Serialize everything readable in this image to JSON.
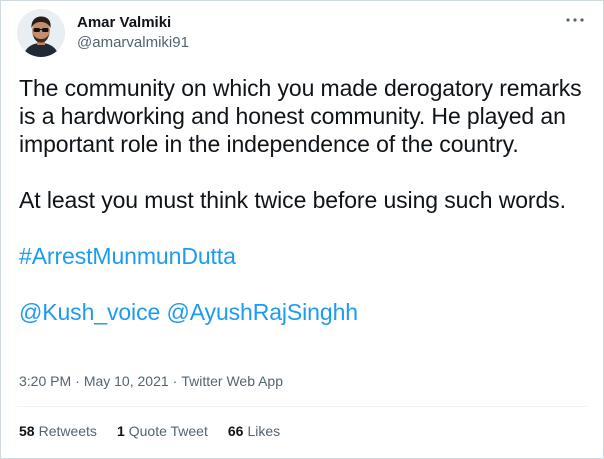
{
  "author": {
    "display_name": "Amar Valmiki",
    "handle": "@amarvalmiki91"
  },
  "tweet": {
    "paragraph1": "The community on which you made derogatory remarks is a hardworking and honest community. He played an important role in the independence of the country.",
    "paragraph2": "At least you must think twice before using such words.",
    "hashtag": "#ArrestMunmunDutta",
    "mention1": "@Kush_voice",
    "mention2": "@AyushRajSinghh"
  },
  "meta": {
    "time": "3:20 PM",
    "separator": "·",
    "date": "May 10, 2021",
    "source": "Twitter Web App"
  },
  "stats": {
    "retweets_count": "58",
    "retweets_label": "Retweets",
    "quotes_count": "1",
    "quotes_label": "Quote Tweet",
    "likes_count": "66",
    "likes_label": "Likes"
  },
  "icons": {
    "more": "more-horizontal-icon"
  },
  "colors": {
    "link": "#1d9bf0",
    "secondary_text": "#536471",
    "primary_text": "#0f1419"
  }
}
